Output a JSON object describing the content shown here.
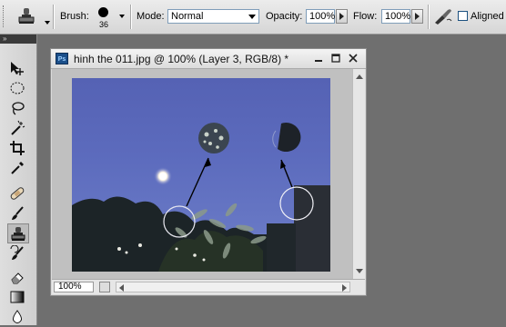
{
  "options_bar": {
    "tool_preset_icon": "clone-stamp-icon",
    "brush_label": "Brush:",
    "brush_size": "36",
    "mode_label": "Mode:",
    "mode_value": "Normal",
    "opacity_label": "Opacity:",
    "opacity_value": "100%",
    "flow_label": "Flow:",
    "flow_value": "100%",
    "airbrush_icon": "airbrush-icon",
    "aligned_label": "Aligned",
    "aligned_checked": false
  },
  "toolbox": {
    "collapse_glyph": "»",
    "tools": [
      {
        "name": "move-tool",
        "icon": "move-icon"
      },
      {
        "name": "marquee-tool",
        "icon": "ellipse-marquee-icon"
      },
      {
        "name": "lasso-tool",
        "icon": "lasso-icon"
      },
      {
        "name": "magic-wand-tool",
        "icon": "magic-wand-icon"
      },
      {
        "name": "crop-tool",
        "icon": "crop-icon"
      },
      {
        "name": "eyedropper-tool",
        "icon": "eyedropper-icon"
      },
      {
        "name": "healing-brush-tool",
        "icon": "bandage-icon"
      },
      {
        "name": "brush-tool",
        "icon": "brush-icon"
      },
      {
        "name": "clone-stamp-tool",
        "icon": "clone-stamp-icon",
        "active": true
      },
      {
        "name": "history-brush-tool",
        "icon": "history-brush-icon"
      },
      {
        "name": "eraser-tool",
        "icon": "eraser-icon"
      },
      {
        "name": "gradient-tool",
        "icon": "gradient-icon"
      },
      {
        "name": "blur-tool",
        "icon": "blur-drop-icon"
      }
    ]
  },
  "document": {
    "app_icon_text": "Ps",
    "title": "hinh the 011.jpg @ 100% (Layer 3, RGB/8) *",
    "zoom_value": "100%",
    "colors": {
      "sky": "#5c6bbd",
      "canvas_bg": "#c0c0c0"
    }
  }
}
